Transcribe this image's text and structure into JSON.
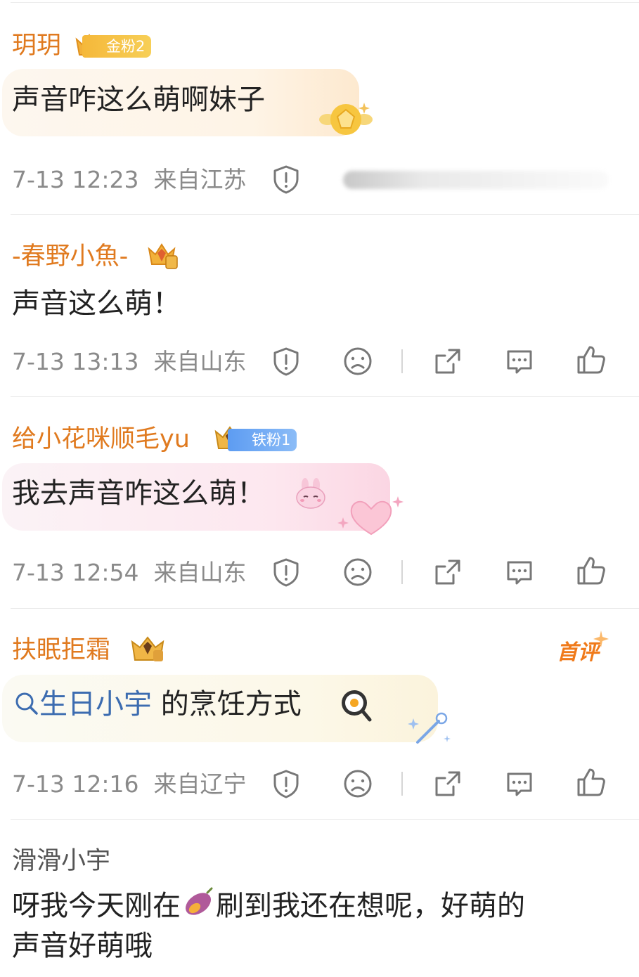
{
  "comments": [
    {
      "username": "玥玥",
      "fan_badge": "金粉2",
      "text": "声音咋这么萌啊妹子",
      "time": "7-13 12:23",
      "location": "来自江苏"
    },
    {
      "username": "-春野小魚-",
      "text": "声音这么萌！",
      "time": "7-13 13:13",
      "location": "来自山东"
    },
    {
      "username": "给小花咪顺毛yu",
      "fan_badge": "铁粉1",
      "text": "我去声音咋这么萌！",
      "time": "7-13 12:54",
      "location": "来自山东"
    },
    {
      "username": "扶眠拒霜",
      "first_comment_tag": "首评",
      "topic": "生日小宇",
      "text_after_topic": "的烹饪方式",
      "time": "7-13 12:16",
      "location": "来自辽宁"
    },
    {
      "username": "滑滑小宇",
      "text_part1": "呀我今天刚在",
      "text_part2": "刷到我还在想呢，好萌的",
      "text_line2": "声音好萌哦"
    }
  ],
  "colors": {
    "username": "#e07a1f",
    "meta": "#8a8a8a",
    "topic_link": "#3c6cb0",
    "gold_badge": "#f5b83a",
    "iron_badge": "#5d9cf2"
  },
  "icons": [
    "report-icon",
    "dislike-face-icon",
    "share-icon",
    "reply-icon",
    "like-icon",
    "crown-icon",
    "magnifier-icon",
    "egg-pan-icon",
    "sweet-potato-icon"
  ]
}
